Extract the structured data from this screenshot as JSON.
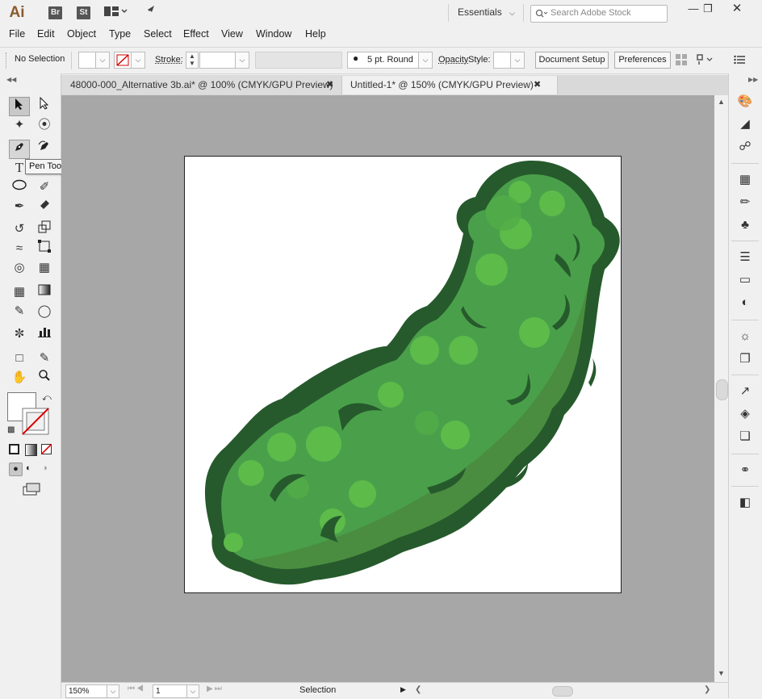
{
  "app": {
    "logo": "Ai",
    "bridge": "Br",
    "stock": "St"
  },
  "workspace": {
    "label": "Essentials"
  },
  "search": {
    "placeholder": "Search Adobe Stock"
  },
  "menu": [
    "File",
    "Edit",
    "Object",
    "Type",
    "Select",
    "Effect",
    "View",
    "Window",
    "Help"
  ],
  "control": {
    "selection_status": "No Selection",
    "stroke_label": "Stroke:",
    "brush_label": "5 pt. Round",
    "opacity_label": "Opacity",
    "style_label": "Style:",
    "document_setup": "Document Setup",
    "preferences": "Preferences"
  },
  "tabs": [
    {
      "label": "48000-000_Alternative 3b.ai* @ 100% (CMYK/GPU Preview)",
      "active": false
    },
    {
      "label": "Untitled-1* @ 150% (CMYK/GPU Preview)",
      "active": true
    }
  ],
  "tooltip": "Pen Tool (P)",
  "status": {
    "zoom": "150%",
    "artboard": "1",
    "tool": "Selection"
  },
  "colors": {
    "pickle_dark": "#265a2c",
    "pickle_mid": "#4aa04a",
    "pickle_light": "#5dbb4a",
    "canvas": "#a7a7a7"
  }
}
